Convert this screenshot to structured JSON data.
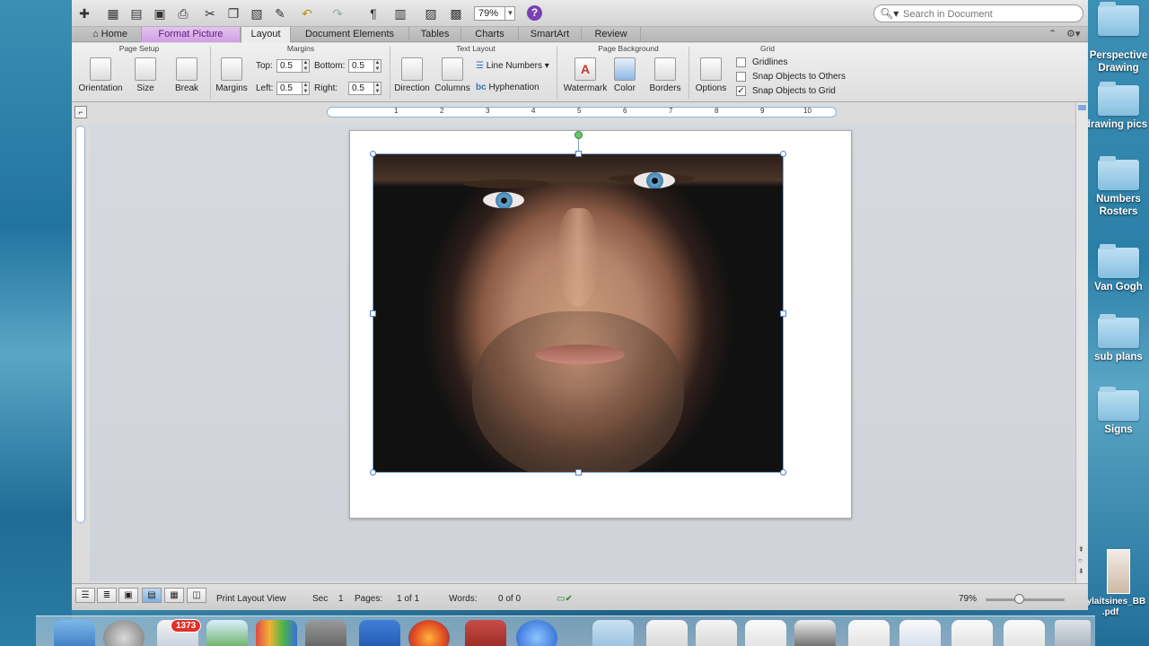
{
  "toolbar": {
    "zoom": "79%",
    "help_glyph": "?",
    "search_placeholder": "Search in Document"
  },
  "tabs": [
    {
      "label": "Home"
    },
    {
      "label": "Format Picture"
    },
    {
      "label": "Layout"
    },
    {
      "label": "Document Elements"
    },
    {
      "label": "Tables"
    },
    {
      "label": "Charts"
    },
    {
      "label": "SmartArt"
    },
    {
      "label": "Review"
    }
  ],
  "ribbon": {
    "groups": {
      "page_setup": "Page Setup",
      "margins": "Margins",
      "text_layout": "Text Layout",
      "page_background": "Page Background",
      "grid": "Grid"
    },
    "buttons": {
      "orientation": "Orientation",
      "size": "Size",
      "break": "Break",
      "margins": "Margins",
      "direction": "Direction",
      "columns": "Columns",
      "line_numbers": "Line Numbers",
      "hyphenation": "Hyphenation",
      "watermark": "Watermark",
      "color": "Color",
      "borders": "Borders",
      "options": "Options"
    },
    "margin_fields": {
      "top_label": "Top:",
      "top_value": "0.5",
      "bottom_label": "Bottom:",
      "bottom_value": "0.5",
      "left_label": "Left:",
      "left_value": "0.5",
      "right_label": "Right:",
      "right_value": "0.5"
    },
    "grid_options": {
      "gridlines": {
        "label": "Gridlines",
        "checked": false
      },
      "snap_others": {
        "label": "Snap Objects to Others",
        "checked": false
      },
      "snap_grid": {
        "label": "Snap Objects to Grid",
        "checked": true
      }
    }
  },
  "ruler": {
    "ticks": [
      "1",
      "2",
      "3",
      "4",
      "5",
      "6",
      "7",
      "8",
      "9",
      "10"
    ]
  },
  "status_bar": {
    "view_name": "Print Layout View",
    "sec_label": "Sec",
    "sec_value": "1",
    "pages_label": "Pages:",
    "pages_value": "1 of 1",
    "words_label": "Words:",
    "words_value": "0 of 0",
    "zoom": "79%"
  },
  "desktop": {
    "items": [
      {
        "label": "Perspective Drawing"
      },
      {
        "label": "drawing pics"
      },
      {
        "label": "Numbers Rosters"
      },
      {
        "label": "Van Gogh"
      },
      {
        "label": "sub plans"
      },
      {
        "label": "Signs"
      },
      {
        "label": "Kaylaitsines_BB .pdf"
      }
    ]
  },
  "dock": {
    "mail_badge": "1373"
  },
  "colors": {
    "format_tab": "#cf9fe3",
    "selection": "#4f82c9",
    "rotation_handle": "#6cc36a"
  }
}
